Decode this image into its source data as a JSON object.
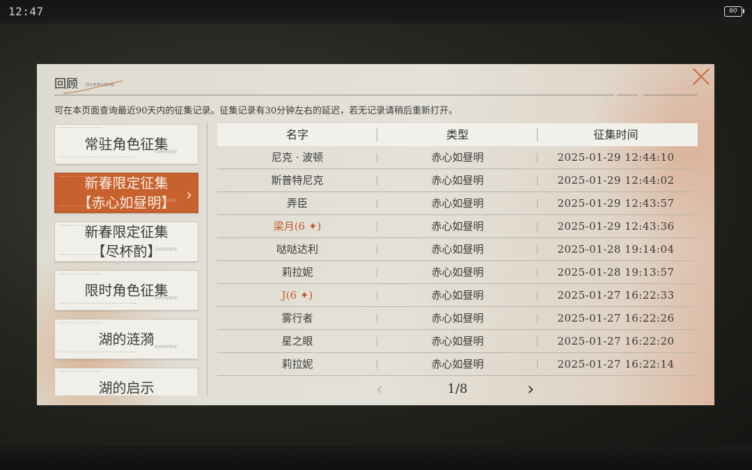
{
  "status": {
    "time": "12:47",
    "battery": "60"
  },
  "panel": {
    "title": "回顾",
    "title_sub": "OVERVIEW",
    "description": "可在本页面查询最近90天内的征集记录。征集记录有30分钟左右的延迟，若无记录请稍后重新打开。"
  },
  "categories": [
    {
      "label": "常驻角色征集",
      "active": false
    },
    {
      "label": "新春限定征集\n【赤心如昼明】",
      "active": true
    },
    {
      "label": "新春限定征集\n【尽杯酌】",
      "active": false
    },
    {
      "label": "限时角色征集",
      "active": false
    },
    {
      "label": "湖的涟漪",
      "active": false
    },
    {
      "label": "湖的启示",
      "active": false
    }
  ],
  "overview_tag": "OVERVIEW",
  "table": {
    "headers": [
      "名字",
      "类型",
      "征集时间"
    ],
    "rows": [
      {
        "name": "尼克 · 波顿",
        "type": "赤心如昼明",
        "time": "2025-01-29 12:44:10",
        "rare": false
      },
      {
        "name": "斯普特尼克",
        "type": "赤心如昼明",
        "time": "2025-01-29 12:44:02",
        "rare": false
      },
      {
        "name": "弄臣",
        "type": "赤心如昼明",
        "time": "2025-01-29 12:43:57",
        "rare": false
      },
      {
        "name": "梁月(6 ✦)",
        "type": "赤心如昼明",
        "time": "2025-01-29 12:43:36",
        "rare": true
      },
      {
        "name": "哒哒达利",
        "type": "赤心如昼明",
        "time": "2025-01-28 19:14:04",
        "rare": false
      },
      {
        "name": "莉拉妮",
        "type": "赤心如昼明",
        "time": "2025-01-28 19:13:57",
        "rare": false
      },
      {
        "name": "J(6 ✦)",
        "type": "赤心如昼明",
        "time": "2025-01-27 16:22:33",
        "rare": true
      },
      {
        "name": "雾行者",
        "type": "赤心如昼明",
        "time": "2025-01-27 16:22:26",
        "rare": false
      },
      {
        "name": "星之眼",
        "type": "赤心如昼明",
        "time": "2025-01-27 16:22:20",
        "rare": false
      },
      {
        "name": "莉拉妮",
        "type": "赤心如昼明",
        "time": "2025-01-27 16:22:14",
        "rare": false
      }
    ]
  },
  "pager": {
    "page": "1/8",
    "prev_icon": "chevron-left-icon",
    "next_icon": "chevron-right-icon"
  },
  "colors": {
    "accent": "#c7622f",
    "rare_text": "#c15a26",
    "panel_bg": "#e3e1d8"
  }
}
